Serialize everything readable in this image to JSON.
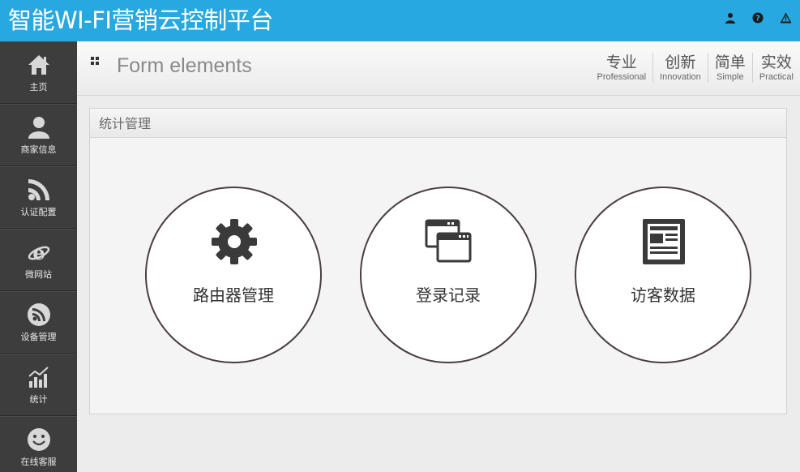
{
  "header": {
    "title": "智能WI-FI营销云控制平台",
    "icons": [
      "user-icon",
      "help-icon",
      "warning-icon"
    ]
  },
  "sidebar": {
    "items": [
      {
        "label": "主页",
        "icon": "home-icon"
      },
      {
        "label": "商家信息",
        "icon": "user-icon"
      },
      {
        "label": "认证配置",
        "icon": "rss-icon"
      },
      {
        "label": "微网站",
        "icon": "ie-icon"
      },
      {
        "label": "设备管理",
        "icon": "rss-circle-icon"
      },
      {
        "label": "统计",
        "icon": "bar-chart-icon"
      },
      {
        "label": "在线客服",
        "icon": "smile-icon"
      }
    ]
  },
  "page": {
    "title": "Form elements",
    "mottos": [
      {
        "cn": "专业",
        "en": "Professional"
      },
      {
        "cn": "创新",
        "en": "Innovation"
      },
      {
        "cn": "简单",
        "en": "Simple"
      },
      {
        "cn": "实效",
        "en": "Practical"
      }
    ]
  },
  "panel": {
    "title": "统计管理",
    "tiles": [
      {
        "label": "路由器管理",
        "icon": "gear-icon"
      },
      {
        "label": "登录记录",
        "icon": "windows-icon"
      },
      {
        "label": "访客数据",
        "icon": "document-icon"
      }
    ]
  },
  "colors": {
    "header_bg": "#28a8e0",
    "sidebar_bg": "#3d3d3d"
  }
}
